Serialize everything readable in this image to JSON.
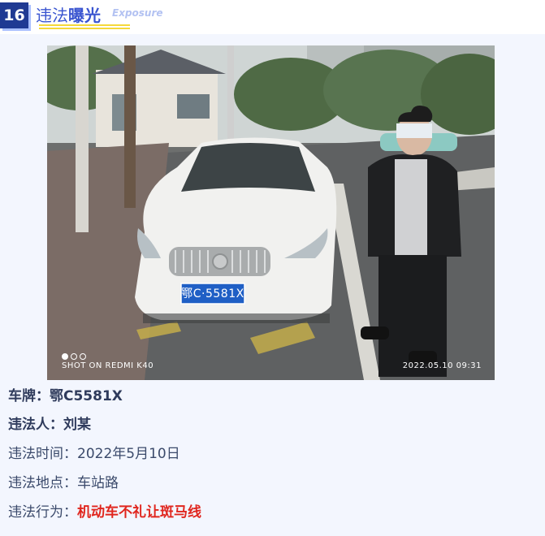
{
  "header": {
    "number": "16",
    "title_part1": "违法",
    "title_part2": "曝光",
    "subtitle": "Exposure"
  },
  "photo": {
    "camera_label": "SHOT ON REDMI K40",
    "timestamp": "2022.05.10 09:31",
    "plate_text": "鄂C·5581X",
    "dots": 3,
    "active_dot": 0
  },
  "details": {
    "plate": {
      "label": "车牌：",
      "value": "鄂C5581X"
    },
    "offender": {
      "label": "违法人：",
      "value": "刘某"
    },
    "time": {
      "label": "违法时间：",
      "value": "2022年5月10日"
    },
    "location": {
      "label": "违法地点：",
      "value": "车站路"
    },
    "behavior": {
      "label": "违法行为：",
      "value": "机动车不礼让斑马线"
    }
  },
  "colors": {
    "badge": "#1f3a93",
    "title": "#3a55d0",
    "underline": "#f5d83a",
    "background": "#f3f6fe",
    "violation_red": "#e0261e"
  }
}
